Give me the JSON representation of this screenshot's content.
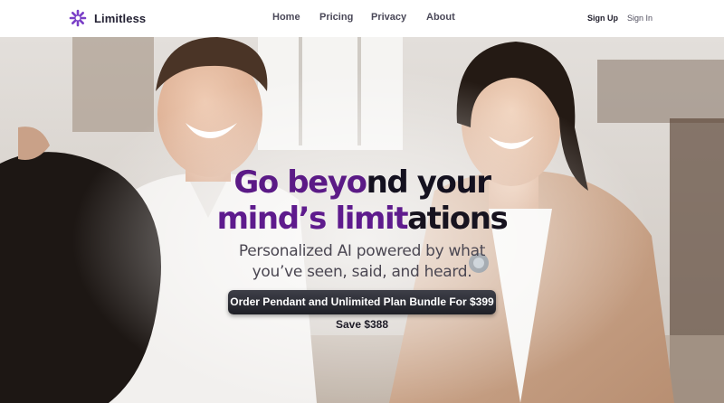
{
  "header": {
    "brand": "Limitless",
    "brand_color": "#7a3fc7",
    "logo_icon": "sparkle-asterisk-icon",
    "nav": [
      {
        "label": "Home"
      },
      {
        "label": "Pricing"
      },
      {
        "label": "Privacy"
      },
      {
        "label": "About"
      }
    ],
    "auth": {
      "signup": "Sign Up",
      "signin": "Sign In"
    }
  },
  "hero": {
    "headline": {
      "line1_accent": "Go beyo",
      "line1_rest": "nd your",
      "line2_accent": "mind’s limit",
      "line2_rest": "ations"
    },
    "subtitle": {
      "line1": "Personalized AI powered by what",
      "line2": "you’ve seen, said, and heard."
    },
    "cta_label": "Order Pendant and Unlimited Plan Bundle For $399",
    "save_label": "Save $388",
    "accent_color": "#5e1b8d",
    "photo_subject": "people-smiling-at-cafe-photo"
  }
}
